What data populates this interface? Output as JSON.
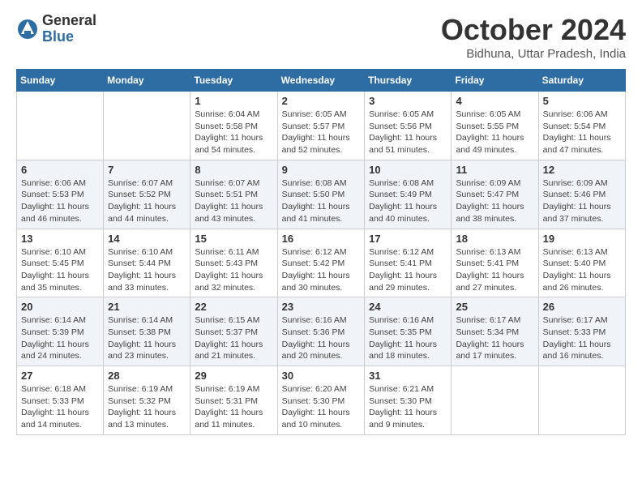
{
  "logo": {
    "general": "General",
    "blue": "Blue"
  },
  "title": "October 2024",
  "subtitle": "Bidhuna, Uttar Pradesh, India",
  "days_of_week": [
    "Sunday",
    "Monday",
    "Tuesday",
    "Wednesday",
    "Thursday",
    "Friday",
    "Saturday"
  ],
  "weeks": [
    [
      {
        "day": "",
        "info": ""
      },
      {
        "day": "",
        "info": ""
      },
      {
        "day": "1",
        "info": "Sunrise: 6:04 AM\nSunset: 5:58 PM\nDaylight: 11 hours and 54 minutes."
      },
      {
        "day": "2",
        "info": "Sunrise: 6:05 AM\nSunset: 5:57 PM\nDaylight: 11 hours and 52 minutes."
      },
      {
        "day": "3",
        "info": "Sunrise: 6:05 AM\nSunset: 5:56 PM\nDaylight: 11 hours and 51 minutes."
      },
      {
        "day": "4",
        "info": "Sunrise: 6:05 AM\nSunset: 5:55 PM\nDaylight: 11 hours and 49 minutes."
      },
      {
        "day": "5",
        "info": "Sunrise: 6:06 AM\nSunset: 5:54 PM\nDaylight: 11 hours and 47 minutes."
      }
    ],
    [
      {
        "day": "6",
        "info": "Sunrise: 6:06 AM\nSunset: 5:53 PM\nDaylight: 11 hours and 46 minutes."
      },
      {
        "day": "7",
        "info": "Sunrise: 6:07 AM\nSunset: 5:52 PM\nDaylight: 11 hours and 44 minutes."
      },
      {
        "day": "8",
        "info": "Sunrise: 6:07 AM\nSunset: 5:51 PM\nDaylight: 11 hours and 43 minutes."
      },
      {
        "day": "9",
        "info": "Sunrise: 6:08 AM\nSunset: 5:50 PM\nDaylight: 11 hours and 41 minutes."
      },
      {
        "day": "10",
        "info": "Sunrise: 6:08 AM\nSunset: 5:49 PM\nDaylight: 11 hours and 40 minutes."
      },
      {
        "day": "11",
        "info": "Sunrise: 6:09 AM\nSunset: 5:47 PM\nDaylight: 11 hours and 38 minutes."
      },
      {
        "day": "12",
        "info": "Sunrise: 6:09 AM\nSunset: 5:46 PM\nDaylight: 11 hours and 37 minutes."
      }
    ],
    [
      {
        "day": "13",
        "info": "Sunrise: 6:10 AM\nSunset: 5:45 PM\nDaylight: 11 hours and 35 minutes."
      },
      {
        "day": "14",
        "info": "Sunrise: 6:10 AM\nSunset: 5:44 PM\nDaylight: 11 hours and 33 minutes."
      },
      {
        "day": "15",
        "info": "Sunrise: 6:11 AM\nSunset: 5:43 PM\nDaylight: 11 hours and 32 minutes."
      },
      {
        "day": "16",
        "info": "Sunrise: 6:12 AM\nSunset: 5:42 PM\nDaylight: 11 hours and 30 minutes."
      },
      {
        "day": "17",
        "info": "Sunrise: 6:12 AM\nSunset: 5:41 PM\nDaylight: 11 hours and 29 minutes."
      },
      {
        "day": "18",
        "info": "Sunrise: 6:13 AM\nSunset: 5:41 PM\nDaylight: 11 hours and 27 minutes."
      },
      {
        "day": "19",
        "info": "Sunrise: 6:13 AM\nSunset: 5:40 PM\nDaylight: 11 hours and 26 minutes."
      }
    ],
    [
      {
        "day": "20",
        "info": "Sunrise: 6:14 AM\nSunset: 5:39 PM\nDaylight: 11 hours and 24 minutes."
      },
      {
        "day": "21",
        "info": "Sunrise: 6:14 AM\nSunset: 5:38 PM\nDaylight: 11 hours and 23 minutes."
      },
      {
        "day": "22",
        "info": "Sunrise: 6:15 AM\nSunset: 5:37 PM\nDaylight: 11 hours and 21 minutes."
      },
      {
        "day": "23",
        "info": "Sunrise: 6:16 AM\nSunset: 5:36 PM\nDaylight: 11 hours and 20 minutes."
      },
      {
        "day": "24",
        "info": "Sunrise: 6:16 AM\nSunset: 5:35 PM\nDaylight: 11 hours and 18 minutes."
      },
      {
        "day": "25",
        "info": "Sunrise: 6:17 AM\nSunset: 5:34 PM\nDaylight: 11 hours and 17 minutes."
      },
      {
        "day": "26",
        "info": "Sunrise: 6:17 AM\nSunset: 5:33 PM\nDaylight: 11 hours and 16 minutes."
      }
    ],
    [
      {
        "day": "27",
        "info": "Sunrise: 6:18 AM\nSunset: 5:33 PM\nDaylight: 11 hours and 14 minutes."
      },
      {
        "day": "28",
        "info": "Sunrise: 6:19 AM\nSunset: 5:32 PM\nDaylight: 11 hours and 13 minutes."
      },
      {
        "day": "29",
        "info": "Sunrise: 6:19 AM\nSunset: 5:31 PM\nDaylight: 11 hours and 11 minutes."
      },
      {
        "day": "30",
        "info": "Sunrise: 6:20 AM\nSunset: 5:30 PM\nDaylight: 11 hours and 10 minutes."
      },
      {
        "day": "31",
        "info": "Sunrise: 6:21 AM\nSunset: 5:30 PM\nDaylight: 11 hours and 9 minutes."
      },
      {
        "day": "",
        "info": ""
      },
      {
        "day": "",
        "info": ""
      }
    ]
  ]
}
